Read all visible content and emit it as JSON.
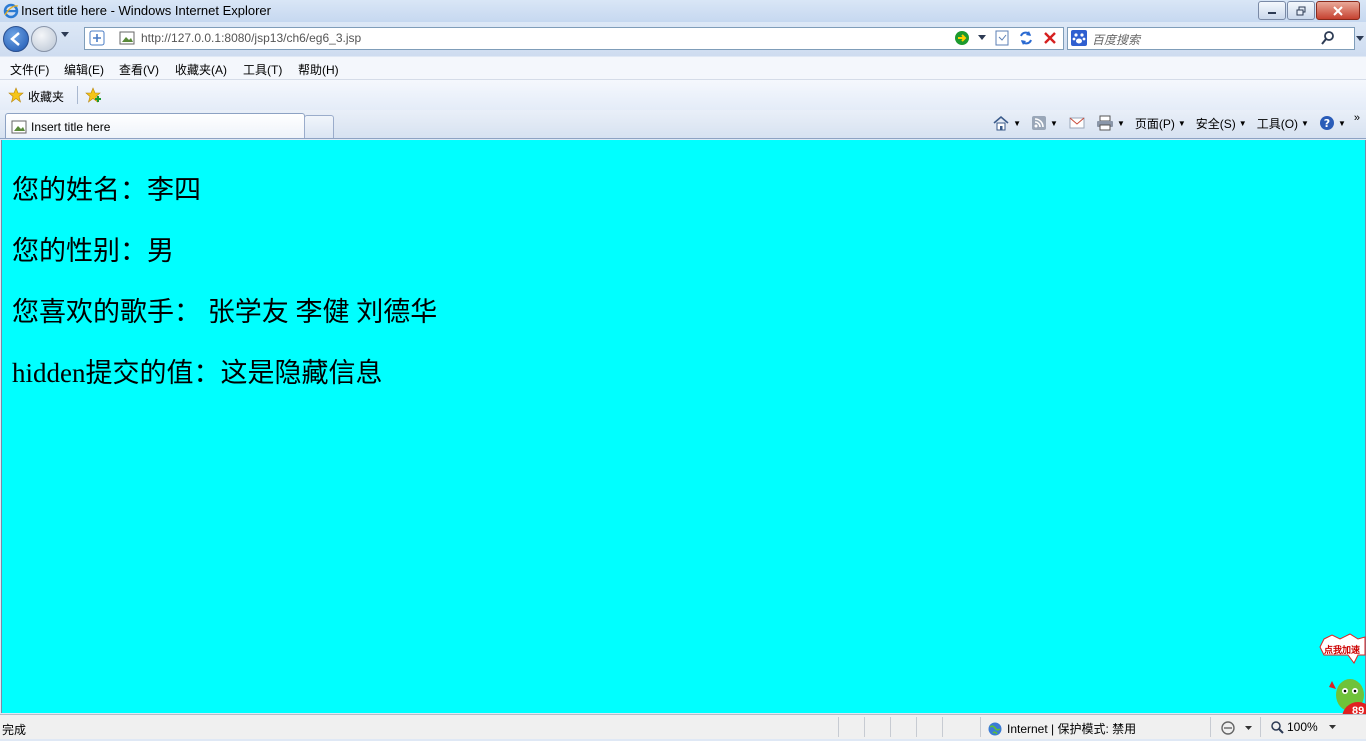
{
  "window": {
    "title": "Insert title here - Windows Internet Explorer"
  },
  "address": {
    "url": "http://127.0.0.1:8080/jsp13/ch6/eg6_3.jsp"
  },
  "search": {
    "placeholder": "百度搜索"
  },
  "menu": {
    "items": [
      "文件(F)",
      "编辑(E)",
      "查看(V)",
      "收藏夹(A)",
      "工具(T)",
      "帮助(H)"
    ]
  },
  "favorites": {
    "label": "收藏夹"
  },
  "tab": {
    "title": "Insert title here"
  },
  "commands": {
    "page": "页面(P)",
    "safety": "安全(S)",
    "tools": "工具(O)"
  },
  "page": {
    "lines": [
      "您的姓名：李四",
      "您的性别：男",
      "您喜欢的歌手： 张学友 李健 刘德华",
      "hidden提交的值：这是隐藏信息"
    ],
    "background": "#00ffff"
  },
  "status": {
    "left": "完成",
    "zone": "Internet | 保护模式: 禁用",
    "zoom": "100%"
  },
  "accelerator": {
    "label": "点我加速",
    "badge": "89"
  }
}
